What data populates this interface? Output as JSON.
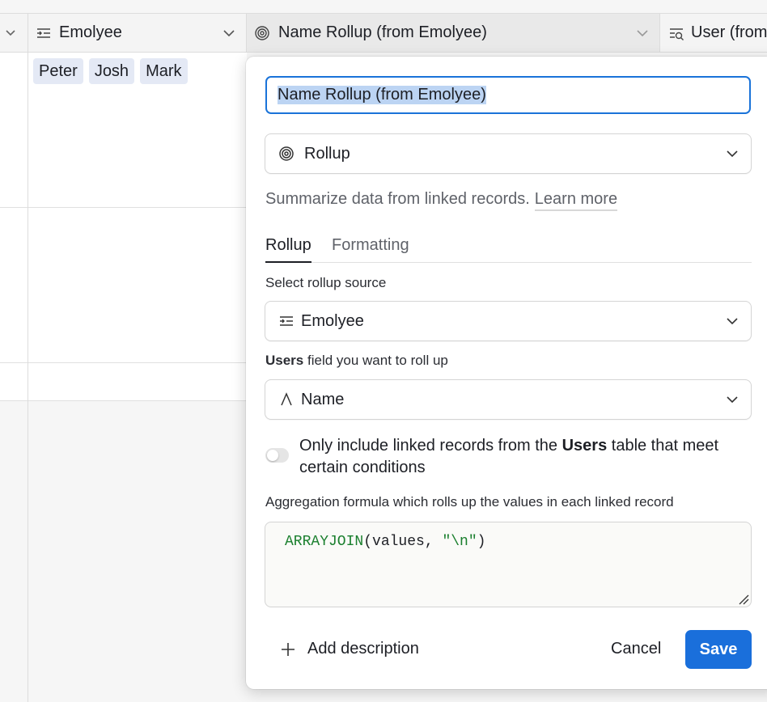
{
  "grid": {
    "columns": [
      {
        "label": "Emolyee",
        "icon": "linked-record-icon"
      },
      {
        "label": "Name Rollup (from Emolyee)",
        "icon": "rollup-icon"
      },
      {
        "label": "User (from",
        "icon": "lookup-icon"
      }
    ],
    "row1_chips": [
      "Peter",
      "Josh",
      "Mark"
    ]
  },
  "popover": {
    "field_name": "Name Rollup (from Emolyee)",
    "field_type": {
      "label": "Rollup",
      "icon": "rollup-icon"
    },
    "description": "Summarize data from linked records.",
    "learn_more": "Learn more",
    "tabs": [
      {
        "label": "Rollup",
        "active": true
      },
      {
        "label": "Formatting",
        "active": false
      }
    ],
    "source_label": "Select rollup source",
    "source_value": {
      "label": "Emolyee",
      "icon": "linked-record-icon"
    },
    "field_label_bold": "Users",
    "field_label_rest": " field you want to roll up",
    "field_value": {
      "label": "Name",
      "icon": "text-field-icon"
    },
    "toggle": {
      "on": false,
      "text_before": "Only include linked records from the ",
      "text_bold": "Users",
      "text_after": " table that meet certain conditions"
    },
    "aggregation_label": "Aggregation formula which rolls up the values in each linked record",
    "formula": {
      "fn": "ARRAYJOIN",
      "open": "(",
      "arg": "values, ",
      "str": "\"\\n\"",
      "close": ")"
    },
    "add_description": "Add description",
    "cancel": "Cancel",
    "save": "Save",
    "colors": {
      "accent": "#1a6fdb",
      "formula_green": "#1a7f2e"
    }
  }
}
